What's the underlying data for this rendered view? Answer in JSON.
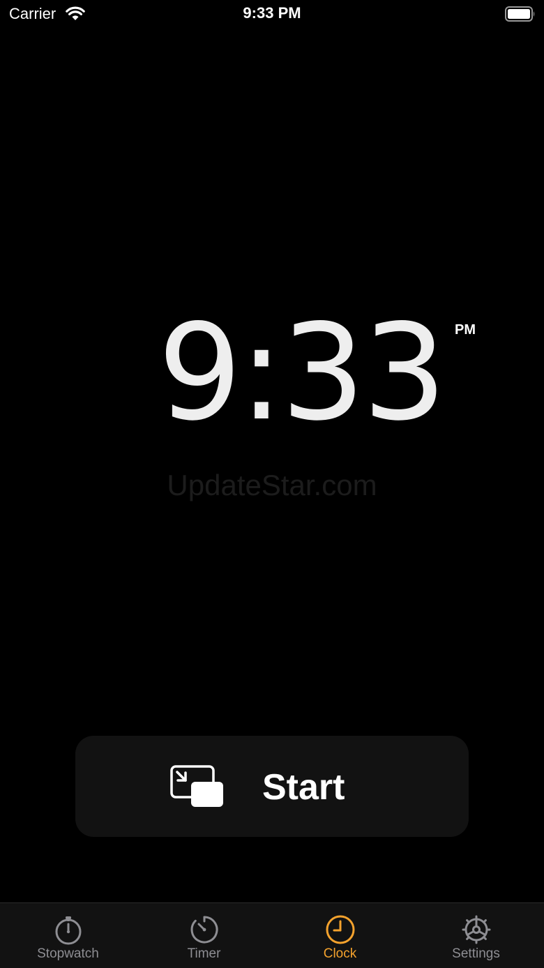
{
  "status_bar": {
    "carrier": "Carrier",
    "time": "9:33 PM",
    "icons": [
      "wifi-icon",
      "battery-icon"
    ]
  },
  "clock": {
    "time": "9:33",
    "ampm": "PM"
  },
  "watermark": "UpdateStar.com",
  "start_button": {
    "label": "Start",
    "icon": "picture-in-picture-icon"
  },
  "tabs": [
    {
      "label": "Stopwatch",
      "icon": "stopwatch-icon",
      "active": false
    },
    {
      "label": "Timer",
      "icon": "timer-icon",
      "active": false
    },
    {
      "label": "Clock",
      "icon": "clock-icon",
      "active": true
    },
    {
      "label": "Settings",
      "icon": "gear-icon",
      "active": false
    }
  ],
  "colors": {
    "background": "#000000",
    "accent": "#F4A22D",
    "inactive_tab": "#8E8E93",
    "button_bg": "#121212"
  }
}
